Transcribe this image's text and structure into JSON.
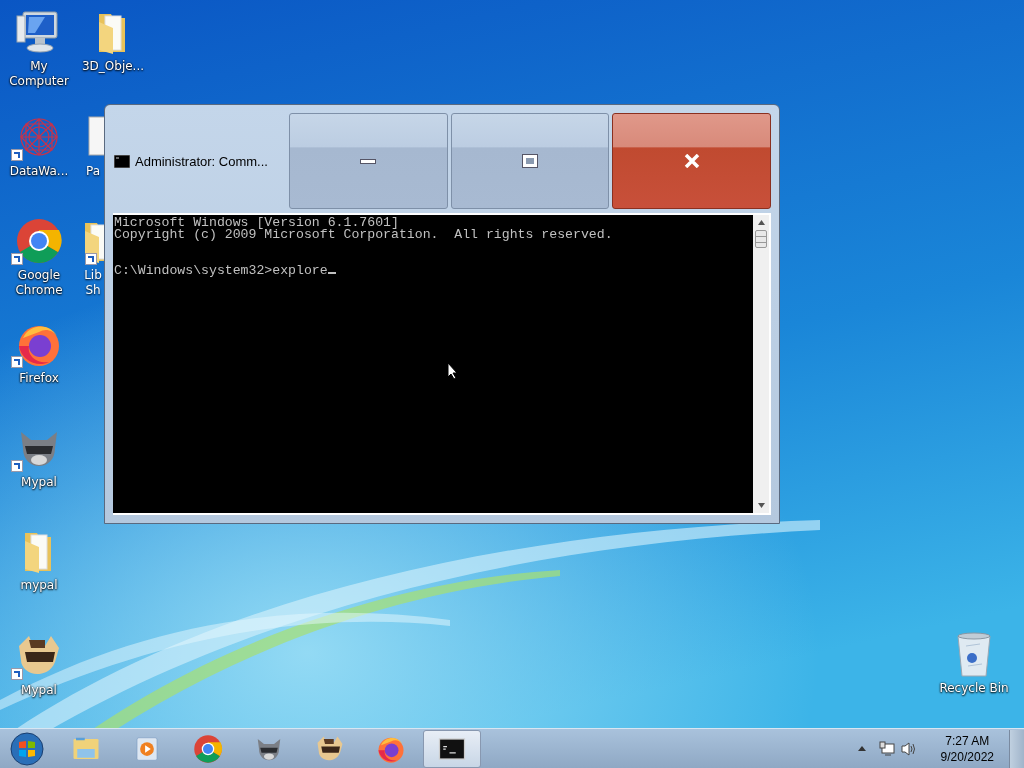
{
  "desktop_icons": [
    {
      "label": "My Computer",
      "kind": "computer",
      "shortcut": false
    },
    {
      "label": "DataWa...",
      "kind": "network",
      "shortcut": true
    },
    {
      "label": "Google Chrome",
      "kind": "chrome",
      "shortcut": true
    },
    {
      "label": "Firefox",
      "kind": "firefox",
      "shortcut": true
    },
    {
      "label": "Mypal",
      "kind": "raccoon",
      "shortcut": true
    },
    {
      "label": "mypal",
      "kind": "folder",
      "shortcut": false
    },
    {
      "label": "Mypal",
      "kind": "raccoon2",
      "shortcut": true
    }
  ],
  "second_column": [
    {
      "label": "3D_Obje...",
      "kind": "folder",
      "shortcut": false
    },
    {
      "label": "Pa",
      "kind": "document",
      "shortcut": false
    },
    {
      "label": "Lib Sh",
      "kind": "folder",
      "shortcut": true
    }
  ],
  "recycle_bin": {
    "label": "Recycle Bin"
  },
  "window": {
    "title": "Administrator: Comm...",
    "console_lines": [
      "Microsoft Windows [Version 6.1.7601]",
      "Copyright (c) 2009 Microsoft Corporation.  All rights reserved."
    ],
    "prompt": "C:\\Windows\\system32>",
    "input": "explore"
  },
  "taskbar": {
    "items": [
      {
        "kind": "explorer",
        "active": false
      },
      {
        "kind": "media",
        "active": false
      },
      {
        "kind": "chrome",
        "active": false
      },
      {
        "kind": "raccoon",
        "active": false
      },
      {
        "kind": "raccoon2",
        "active": false
      },
      {
        "kind": "firefox",
        "active": false
      },
      {
        "kind": "cmd",
        "active": true
      }
    ],
    "clock": {
      "time": "7:27 AM",
      "date": "9/20/2022"
    }
  }
}
